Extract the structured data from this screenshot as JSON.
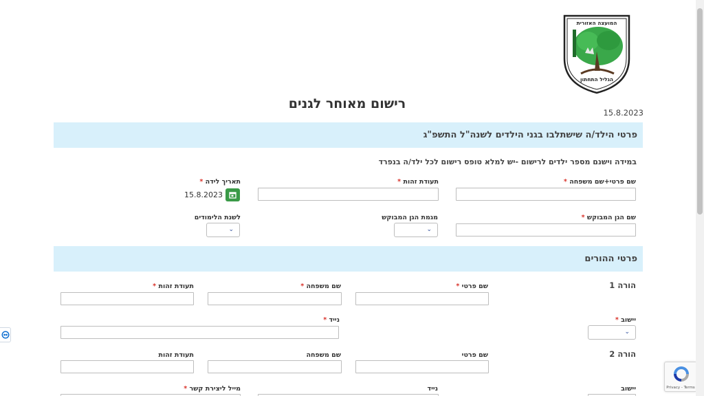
{
  "logo": {
    "top_text": "המועצה האזורית",
    "bottom_text": "הגליל התחתון"
  },
  "header": {
    "title": "רישום מאוחר לגנים",
    "date": "15.8.2023"
  },
  "child_section": {
    "title": "פרטי הילד/ה שישתלבו בגני הילדים לשנה\"ל התשפ\"ג",
    "note": "במידה וישנם מספר ילדים לרישום -יש למלא טופס רישום לכל ילד/ה בנפרד",
    "full_name_label": "שם פרטי+שם משפחה",
    "id_label": "תעודת זהות",
    "birthdate_label": "תאריך לידה",
    "birthdate_value": "15.8.2023",
    "kindergarten_label": "שם הגן המבוקש",
    "kg_track_label": "מגמת הגן המבוקש",
    "school_year_label": "לשנת הלימודים"
  },
  "parents_section": {
    "title": "פרטי ההורים",
    "parent1": {
      "heading": "הורה 1",
      "first_name_label": "שם פרטי",
      "last_name_label": "שם משפחה",
      "id_label": "תעודת זהות",
      "settlement_label": "יישוב",
      "mobile_label": "נייד"
    },
    "parent2": {
      "heading": "הורה 2",
      "first_name_label": "שם פרטי",
      "last_name_label": "שם משפחה",
      "id_label": "תעודת זהות",
      "settlement_label": "יישוב",
      "mobile_label": "נייד",
      "email_label": "מייל ליצירת קשר"
    }
  },
  "required_mark": "*",
  "recaptcha": {
    "terms": "Privacy - Terms"
  },
  "colors": {
    "section_bg": "#d8f0fb",
    "accent_green": "#3a9a47",
    "required": "#d9332b"
  },
  "icons": {
    "calendar": "calendar-icon",
    "chevron": "chevron-down-icon",
    "side": "teamviewer-icon",
    "captcha": "recaptcha-icon"
  }
}
